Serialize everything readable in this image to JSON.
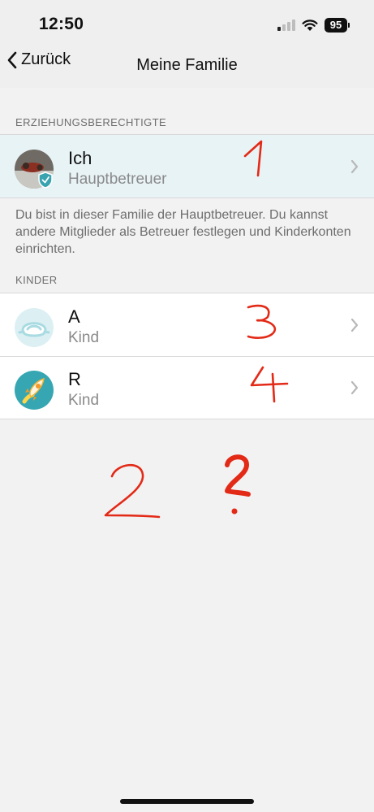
{
  "status_bar": {
    "time": "12:50",
    "battery": "95"
  },
  "nav": {
    "back_label": "Zurück",
    "title": "Meine Familie"
  },
  "guardians": {
    "header": "ERZIEHUNGSBERECHTIGTE",
    "items": [
      {
        "name": "Ich",
        "role": "Hauptbetreuer"
      }
    ],
    "note": "Du bist in dieser Familie der Hauptbetreuer. Du kannst andere Mitglieder als Betreuer festlegen und Kinderkonten einrichten."
  },
  "children": {
    "header": "KINDER",
    "items": [
      {
        "name": "A",
        "role": "Kind"
      },
      {
        "name": "R",
        "role": "Kind"
      }
    ]
  },
  "annotations": [
    "1",
    "3",
    "4",
    "2",
    "?"
  ],
  "colors": {
    "annotation": "#e32a17",
    "selected_row": "#e8f3f6",
    "accent_teal": "#3aa3b0"
  }
}
